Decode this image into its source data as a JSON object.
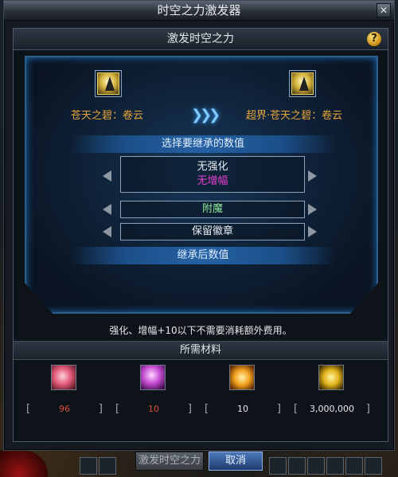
{
  "window": {
    "title": "时空之力激发器"
  },
  "panel": {
    "title": "激发时空之力",
    "help_label": "?"
  },
  "items": {
    "source_name": "苍天之碧：卷云",
    "target_name": "超界·苍天之碧：卷云",
    "arrow": "❯❯❯"
  },
  "inherit": {
    "header": "选择要继承的数值",
    "option1_line1": "无强化",
    "option1_line2": "无增幅",
    "option2": "附魔",
    "option3": "保留徽章",
    "result_header": "继承后数值"
  },
  "note": "强化、增幅+10以下不需要消耗额外费用。",
  "materials": {
    "header": "所需材料",
    "list": [
      {
        "icon": "pink-crystal-icon",
        "value": "96",
        "color": "#d64a3a"
      },
      {
        "icon": "purple-orb-icon",
        "value": "10",
        "color": "#d64a3a"
      },
      {
        "icon": "golden-rune-icon",
        "value": "10",
        "color": "#e8ecf0"
      },
      {
        "icon": "gold-coins-icon",
        "value": "3,000,000",
        "color": "#e8ecf0"
      }
    ]
  },
  "buttons": {
    "activate": "激发时空之力",
    "cancel": "取消"
  },
  "colors": {
    "accent": "#2d5f8e",
    "item_name": "#e7a53a",
    "zero_amp": "#e83fd2",
    "green_option": "#8fe79a"
  }
}
